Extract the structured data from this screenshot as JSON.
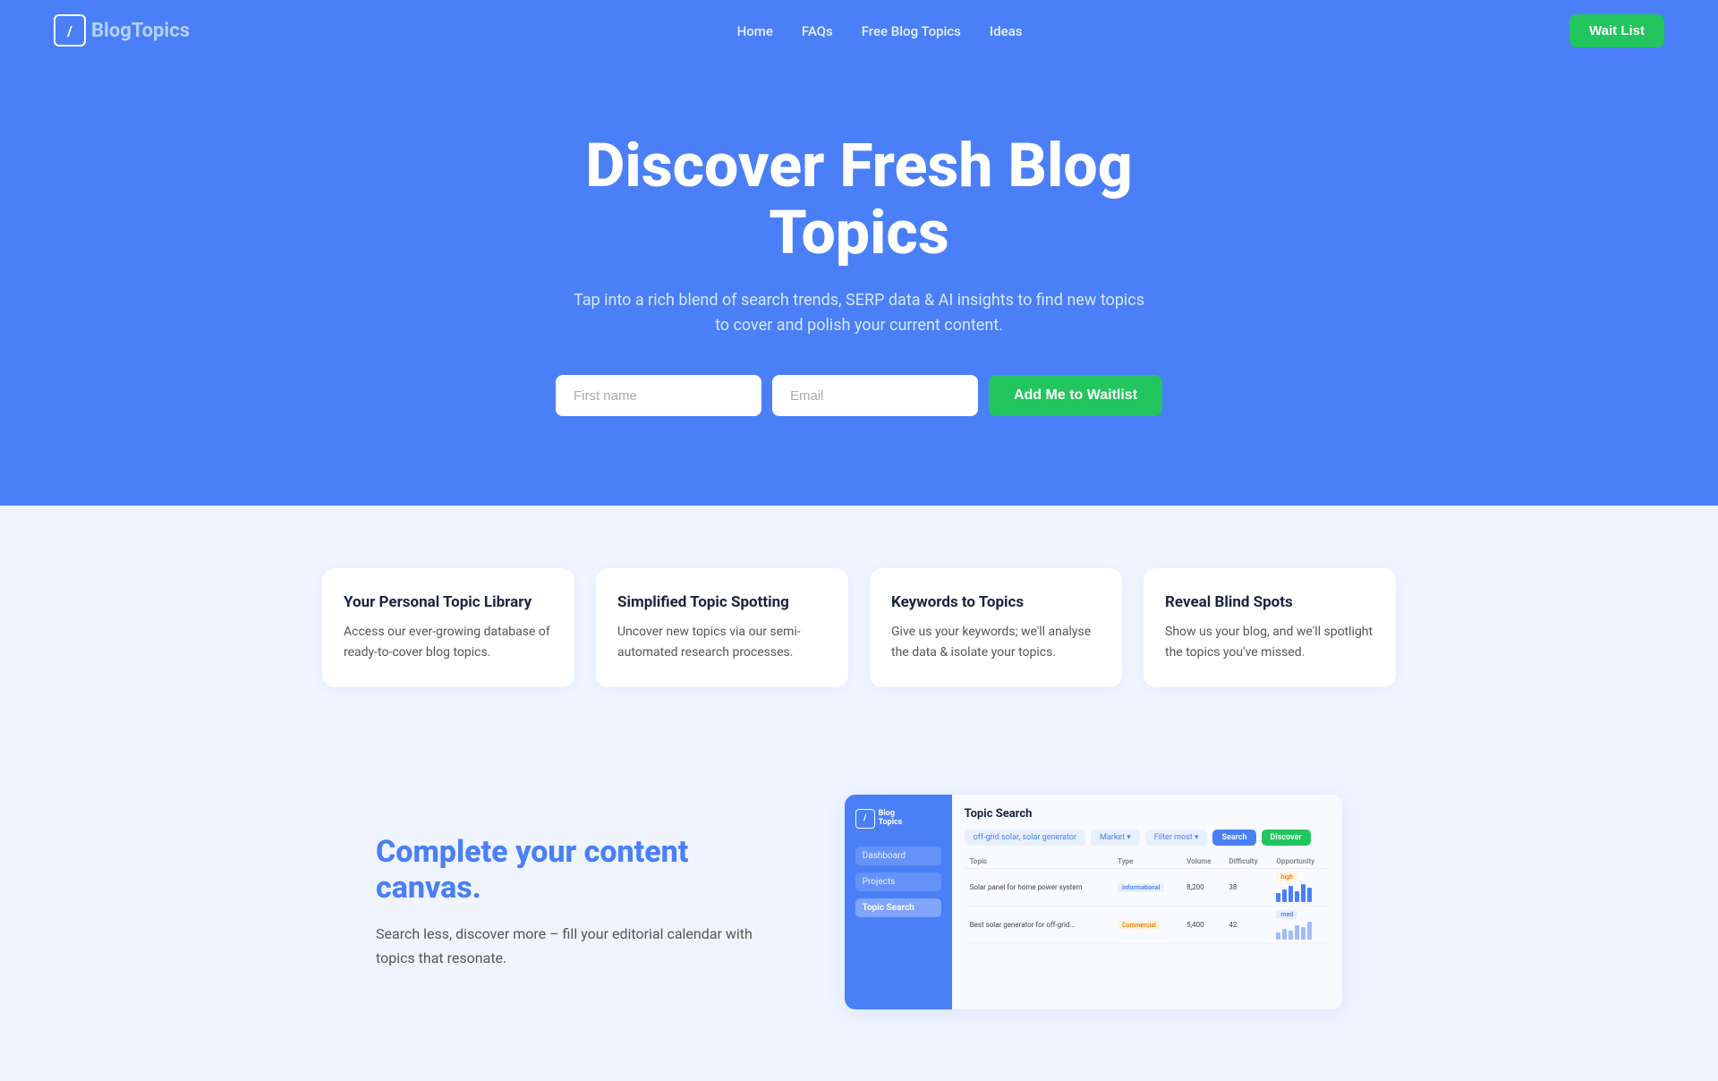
{
  "nav": {
    "logo_slash": "/",
    "logo_bold": "Blog",
    "logo_light": "Topics",
    "links": [
      "Home",
      "FAQs",
      "Free Blog Topics",
      "Ideas"
    ],
    "waitlist_btn": "Wait List"
  },
  "hero": {
    "headline": "Discover Fresh Blog Topics",
    "subtext": "Tap into a rich blend of search trends, SERP data & AI insights to find new topics to cover and polish your current content.",
    "input_firstname_placeholder": "First name",
    "input_email_placeholder": "Email",
    "cta_btn": "Add Me to Waitlist"
  },
  "features": [
    {
      "title": "Your Personal Topic Library",
      "desc": "Access our ever-growing database of ready-to-cover blog topics."
    },
    {
      "title": "Simplified Topic Spotting",
      "desc": "Uncover new topics via our semi-automated research processes."
    },
    {
      "title": "Keywords to Topics",
      "desc": "Give us your keywords; we'll analyse the data & isolate your topics."
    },
    {
      "title": "Reveal Blind Spots",
      "desc": "Show us your blog, and we'll spotlight the topics you've missed."
    }
  ],
  "canvas": {
    "label_static": "Complete your",
    "label_highlight": "content canvas.",
    "desc": "Search less, discover more – fill your editorial calendar with topics that resonate."
  },
  "mockup": {
    "sidebar_items": [
      "Dashboard",
      "Projects",
      "Topic Search"
    ],
    "main_title": "Topic Search",
    "filter_labels": [
      "off-grid solar, solar generator",
      "Market ▾",
      "Filter most ▾"
    ],
    "search_btn": "Search",
    "discover_btn": "Discover",
    "table_headers": [
      "Topic",
      "Type",
      "Volume",
      "Difficulty",
      "Opportunity"
    ],
    "table_rows": [
      [
        "Solar panel for home power system",
        "Informational",
        "8,200",
        "38",
        "high"
      ],
      [
        "Best solar generator for off-grid...",
        "Commercial",
        "5,400",
        "42",
        "med"
      ]
    ]
  },
  "colors": {
    "accent_blue": "#4a7ff7",
    "accent_green": "#22c55e",
    "text_dark": "#1a2340",
    "text_mid": "#555",
    "bg_hero": "#4a7ff7",
    "bg_body": "#f0f4ff"
  }
}
